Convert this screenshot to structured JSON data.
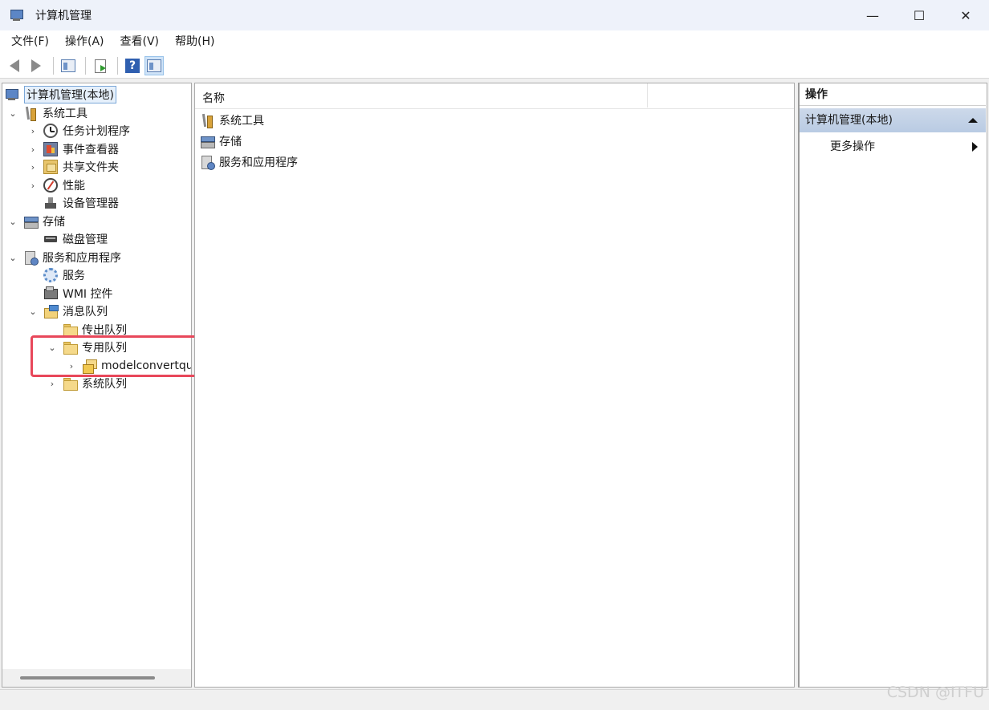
{
  "window": {
    "title": "计算机管理",
    "minimize": "—",
    "maximize": "☐",
    "close": "✕"
  },
  "menu": [
    "文件(F)",
    "操作(A)",
    "查看(V)",
    "帮助(H)"
  ],
  "toolbar": {
    "back": "back-arrow-icon",
    "forward": "forward-arrow-icon",
    "show_hide_tree": "console-tree-icon",
    "export": "export-list-icon",
    "help": "?",
    "show_hide_action": "action-pane-icon"
  },
  "tree": {
    "root": "计算机管理(本地)",
    "system_tools": "系统工具",
    "task_scheduler": "任务计划程序",
    "event_viewer": "事件查看器",
    "shared_folders": "共享文件夹",
    "performance": "性能",
    "device_manager": "设备管理器",
    "storage": "存储",
    "disk_management": "磁盘管理",
    "services_apps": "服务和应用程序",
    "services": "服务",
    "wmi": "WMI 控件",
    "message_queuing": "消息队列",
    "outgoing_queues": "传出队列",
    "private_queues": "专用队列",
    "private_queue_item": "modelconvertqu",
    "system_queues": "系统队列"
  },
  "list": {
    "column_name": "名称",
    "items": [
      "系统工具",
      "存储",
      "服务和应用程序"
    ]
  },
  "actions": {
    "header": "操作",
    "section": "计算机管理(本地)",
    "more": "更多操作"
  },
  "watermark": "CSDN @ITFU"
}
